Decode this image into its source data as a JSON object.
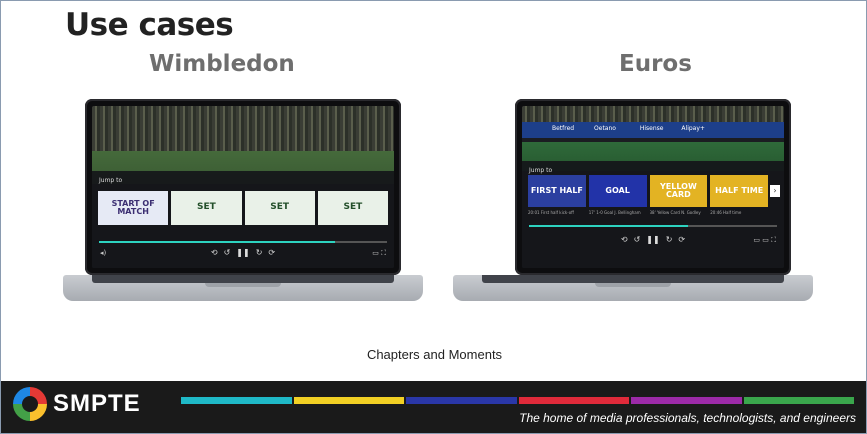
{
  "slide": {
    "title": "Use cases",
    "caption": "Chapters and Moments",
    "tagline": "The home of media professionals, technologists, and engineers"
  },
  "brand": {
    "logo_text": "SMPTE",
    "stripe_colors": [
      "#1fb9c7",
      "#f2d024",
      "#2a37a8",
      "#e02a3a",
      "#9c2aa8",
      "#3aa64c"
    ]
  },
  "wimbledon": {
    "label": "Wimbledon",
    "jump_to": "Jump to",
    "chips": [
      "START OF MATCH",
      "SET",
      "SET",
      "SET"
    ],
    "progress": 0.82
  },
  "euros": {
    "label": "Euros",
    "jump_to": "Jump to",
    "chips": [
      "FIRST HALF",
      "GOAL",
      "YELLOW CARD",
      "HALF TIME"
    ],
    "chip_colors": [
      "#2b3fa0",
      "#2233a8",
      "#e3b323",
      "#e3b323"
    ],
    "chip_captions": [
      "20:01 First half kick-off",
      "17' 1-0 Goal J. Bellingham",
      "38' Yellow Card N. Godley",
      "20:46 Half time"
    ],
    "adboards": [
      "Betfred",
      "Oetano",
      "Hisense",
      "Alipay+"
    ],
    "progress": 0.64
  }
}
